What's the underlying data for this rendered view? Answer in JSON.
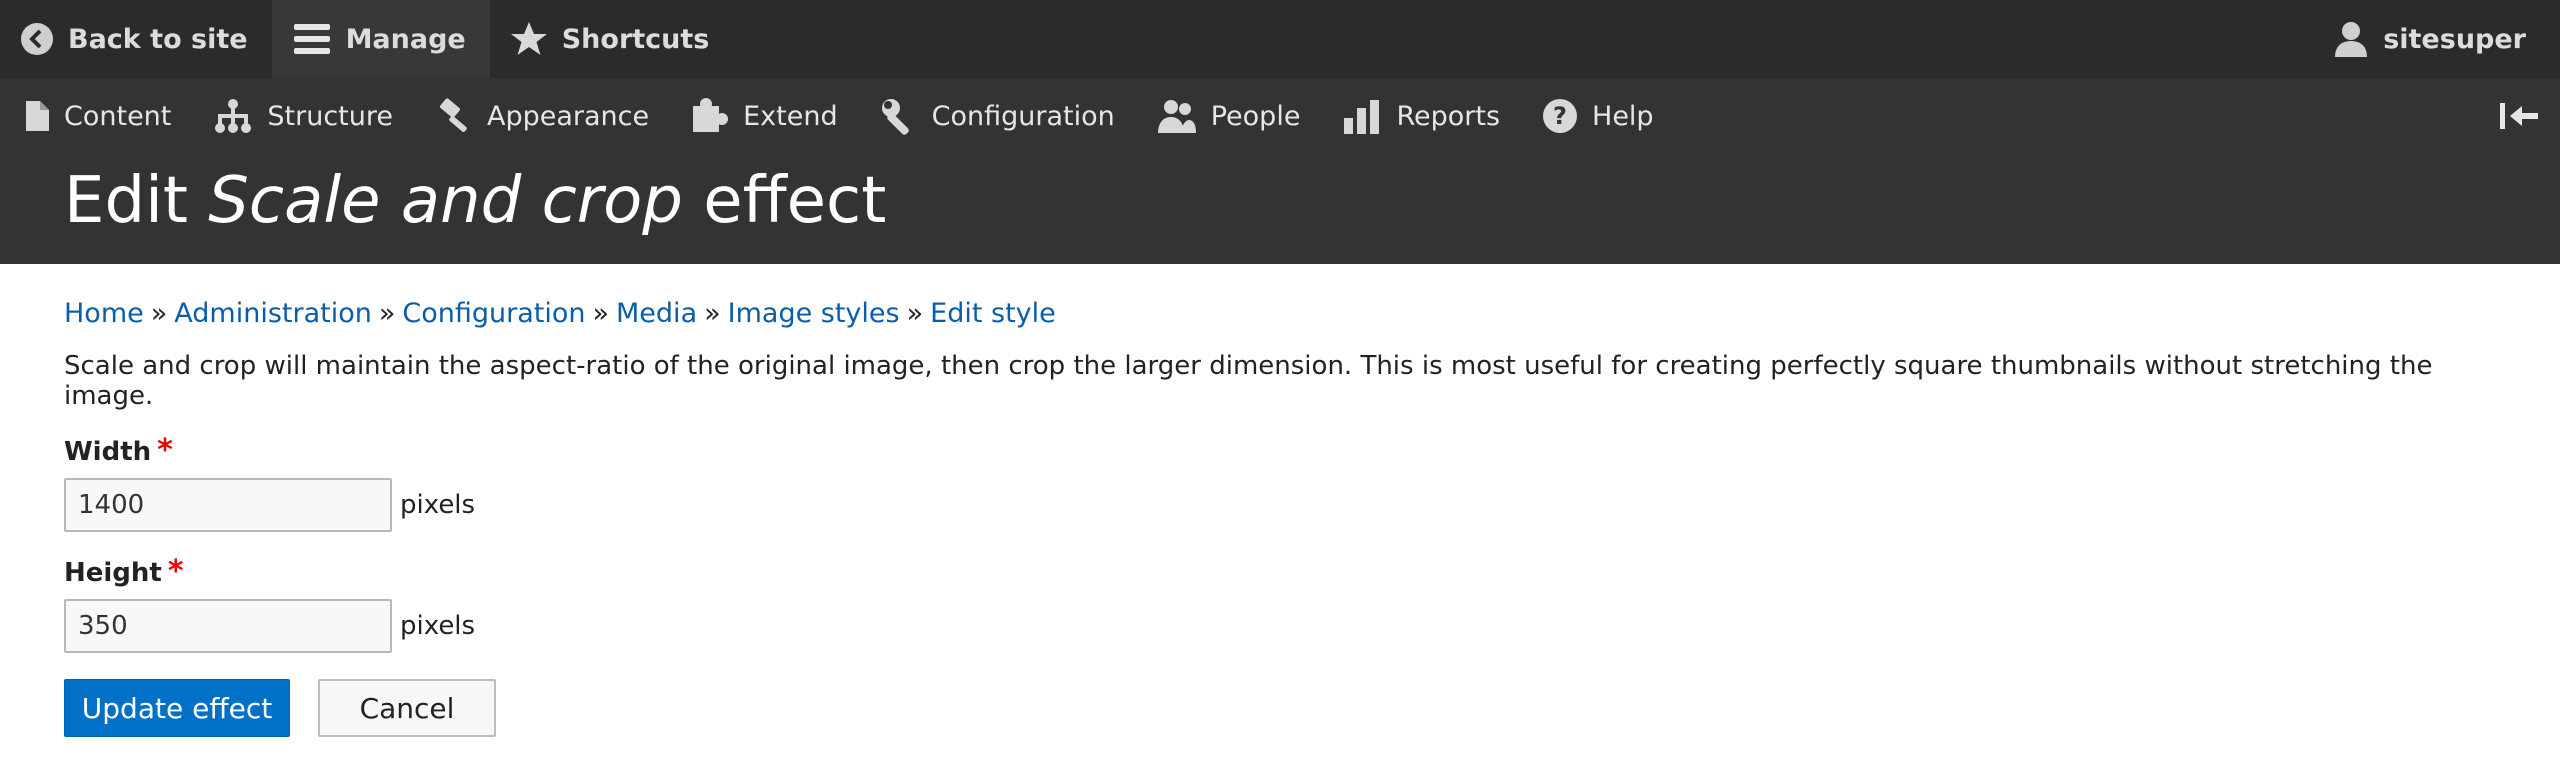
{
  "toolbar": {
    "back_label": "Back to site",
    "manage_label": "Manage",
    "shortcuts_label": "Shortcuts",
    "user_label": "sitesuper"
  },
  "tray": {
    "items": [
      {
        "label": "Content",
        "icon": "file-icon"
      },
      {
        "label": "Structure",
        "icon": "sitemap-icon"
      },
      {
        "label": "Appearance",
        "icon": "paintbrush-icon"
      },
      {
        "label": "Extend",
        "icon": "puzzle-icon"
      },
      {
        "label": "Configuration",
        "icon": "wrench-icon"
      },
      {
        "label": "People",
        "icon": "people-icon"
      },
      {
        "label": "Reports",
        "icon": "bar-chart-icon"
      },
      {
        "label": "Help",
        "icon": "help-icon"
      }
    ]
  },
  "page": {
    "title_prefix": "Edit ",
    "title_em": "Scale and crop",
    "title_suffix": " effect"
  },
  "breadcrumb": [
    "Home",
    "Administration",
    "Configuration",
    "Media",
    "Image styles",
    "Edit style"
  ],
  "breadcrumb_sep": "»",
  "description": "Scale and crop will maintain the aspect-ratio of the original image, then crop the larger dimension. This is most useful for creating perfectly square thumbnails without stretching the image.",
  "form": {
    "width": {
      "label": "Width",
      "required_mark": "*",
      "value": "1400",
      "suffix": "pixels"
    },
    "height": {
      "label": "Height",
      "required_mark": "*",
      "value": "350",
      "suffix": "pixels"
    },
    "submit_label": "Update effect",
    "cancel_label": "Cancel"
  },
  "colors": {
    "toolbar_bg": "#2b2b2b",
    "tray_bg": "#333333",
    "link": "#0a5ea8",
    "primary_button": "#0071c6",
    "required": "#e00000"
  }
}
